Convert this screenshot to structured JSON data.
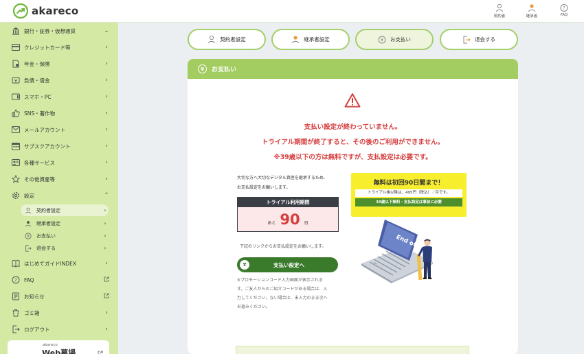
{
  "app": {
    "logo_text": "akareco"
  },
  "header": {
    "nav": [
      {
        "label": "契約者",
        "icon": "user-icon"
      },
      {
        "label": "継承者",
        "icon": "heir-icon"
      },
      {
        "label": "FAQ",
        "icon": "help-icon"
      }
    ]
  },
  "sidebar": {
    "items": [
      {
        "label": "銀行・証券・仮想通貨",
        "icon": "bank-icon",
        "arrow": "chevron-down"
      },
      {
        "label": "クレジットカード等",
        "icon": "credit-card-icon",
        "arrow": "chevron-right"
      },
      {
        "label": "年金・保険",
        "icon": "pension-icon",
        "arrow": "chevron-right"
      },
      {
        "label": "負債・借金",
        "icon": "debt-icon",
        "arrow": "chevron-right"
      },
      {
        "label": "スマホ・PC",
        "icon": "smartphone-icon",
        "arrow": "chevron-right"
      },
      {
        "label": "SNS・著作物",
        "icon": "thumbs-up-icon",
        "arrow": "chevron-right"
      },
      {
        "label": "メールアカウント",
        "icon": "mail-icon",
        "arrow": "chevron-right"
      },
      {
        "label": "サブスクアカウント",
        "icon": "calendar-icon",
        "arrow": "chevron-right"
      },
      {
        "label": "各種サービス",
        "icon": "id-card-icon",
        "arrow": "chevron-right"
      },
      {
        "label": "その他資産等",
        "icon": "star-icon",
        "arrow": "chevron-right"
      },
      {
        "label": "設定",
        "icon": "gear-icon",
        "arrow": "chevron-up"
      }
    ],
    "subitems": [
      {
        "label": "契約者設定",
        "icon": "user-icon",
        "active": true
      },
      {
        "label": "継承者設定",
        "icon": "heir-icon",
        "active": false
      },
      {
        "label": "お支払い",
        "icon": "yen-icon",
        "active": false
      },
      {
        "label": "退会する",
        "icon": "logout-icon",
        "active": false
      }
    ],
    "bottom_items": [
      {
        "label": "はじめてガイドINDEX",
        "icon": "book-icon",
        "arrow": "chevron-right"
      },
      {
        "label": "FAQ",
        "icon": "help-icon",
        "arrow": "external-link"
      },
      {
        "label": "お知らせ",
        "icon": "notice-icon",
        "arrow": "external-link"
      },
      {
        "label": "ゴミ箱",
        "icon": "trash-icon",
        "arrow": "chevron-right"
      },
      {
        "label": "ログアウト",
        "icon": "logout-icon",
        "arrow": "chevron-right"
      }
    ],
    "web_banner": {
      "small": "akareco",
      "title": "Web墓場"
    }
  },
  "tabs": [
    {
      "label": "契約者設定",
      "icon": "user-icon",
      "active": false
    },
    {
      "label": "継承者設定",
      "icon": "heir-icon",
      "active": false
    },
    {
      "label": "お支払い",
      "icon": "yen-icon",
      "active": true
    },
    {
      "label": "退会する",
      "icon": "logout-icon",
      "active": false
    }
  ],
  "card": {
    "title": "お支払い",
    "warning_lines": [
      "支払い設定が終わっていません。",
      "トライアル期間が終了すると、その後のご利用ができません。",
      "※39歳以下の方は無料ですが、支払設定は必要です。"
    ],
    "intro_lines": [
      "大切な方へ大切なデジタル資産を継承するため、",
      "お支払設定をお願いします。"
    ],
    "trial": {
      "header": "トライアル利用期間",
      "prefix": "あと",
      "days": "90",
      "suffix": "日"
    },
    "link_note": "下記のリンクからお支払設定をお願いします。",
    "pay_button": "支払い設定へ",
    "note_lines": [
      "※プロモーションコード入力画面が表示されま",
      "す。ご友人からのご紹介コードがある場合は、入",
      "力してください。ない場合は、未入力のまま次へ",
      "お進みください。"
    ],
    "promo": {
      "headline": "無料は初回90日間まで！",
      "price_line": "トライアル後以降は、495円（税込）／月です。",
      "green_line": "39歳以下無料・支払設定は事前に必要"
    },
    "illustration_text": "End of trial"
  },
  "colors": {
    "accent": "#a3cc61",
    "sidebar": "#d4eaa4",
    "warning": "#d63e3e",
    "button": "#3a7a2b",
    "promo": "#f7ee2e"
  }
}
